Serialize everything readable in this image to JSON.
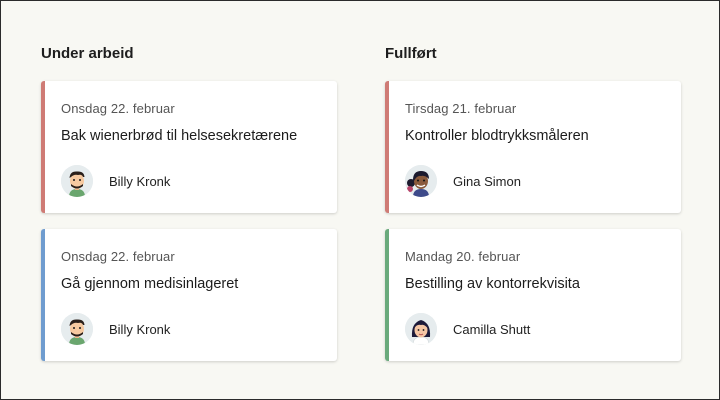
{
  "columns": [
    {
      "title": "Under arbeid",
      "cards": [
        {
          "date": "Onsdag 22. februar",
          "title": "Bak wienerbrød til helsesekretærene",
          "person": "Billy Kronk",
          "accent": "#cf7b75",
          "avatar": "man-avatar-icon"
        },
        {
          "date": "Onsdag 22. februar",
          "title": "Gå gjennom medisinlageret",
          "person": "Billy Kronk",
          "accent": "#6f9ccf",
          "avatar": "man-avatar-icon"
        }
      ]
    },
    {
      "title": "Fullført",
      "cards": [
        {
          "date": "Tirsdag 21. februar",
          "title": "Kontroller blodtrykksmåleren",
          "person": "Gina Simon",
          "accent": "#cf7b75",
          "avatar": "woman-curly-avatar-icon"
        },
        {
          "date": "Mandag 20. februar",
          "title": "Bestilling av kontorrekvisita",
          "person": "Camilla Shutt",
          "accent": "#6aaa7c",
          "avatar": "woman-avatar-icon"
        }
      ]
    }
  ]
}
